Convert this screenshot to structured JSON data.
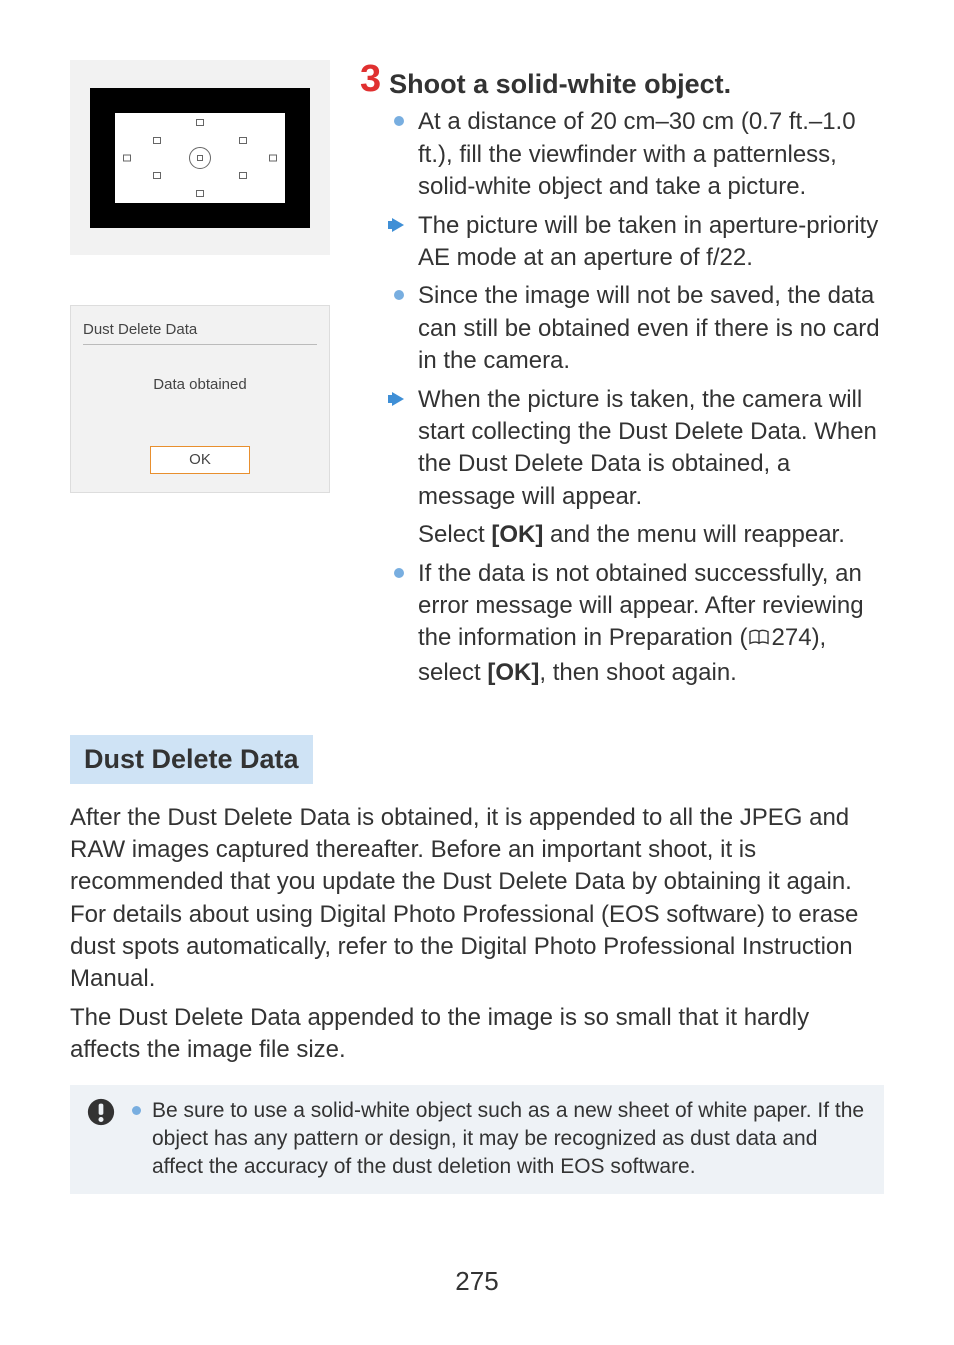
{
  "step": {
    "number": "3",
    "title": "Shoot a solid-white object.",
    "items": [
      {
        "kind": "bullet",
        "text": "At a distance of 20 cm–30 cm (0.7 ft.–1.0 ft.), fill the viewfinder with a patternless, solid-white object and take a picture."
      },
      {
        "kind": "arrow",
        "text": "The picture will be taken in aperture-priority AE mode at an aperture of f/22."
      },
      {
        "kind": "bullet",
        "text": "Since the image will not be saved, the data can still be obtained even if there is no card in the camera."
      },
      {
        "kind": "arrow",
        "text": "When the picture is taken, the camera will start collecting the Dust Delete Data. When the Dust Delete Data is obtained, a message will appear."
      },
      {
        "kind": "plain",
        "text_pre": "Select ",
        "bold1": "[OK]",
        "text_post": " and the menu will reappear."
      },
      {
        "kind": "bullet",
        "text_pre": "If the data is not obtained successfully, an error message will appear. After reviewing the information in Preparation (",
        "ref": "274",
        "text_mid": "), select ",
        "bold1": "[OK]",
        "text_post": ", then shoot again."
      }
    ]
  },
  "dialog": {
    "title": "Dust Delete Data",
    "message": "Data obtained",
    "ok": "OK"
  },
  "section": {
    "label": "Dust Delete Data",
    "para1": "After the Dust Delete Data is obtained, it is appended to all the JPEG and RAW images captured thereafter. Before an important shoot, it is recommended that you update the Dust Delete Data by obtaining it again. For details about using Digital Photo Professional (EOS software) to erase dust spots automatically, refer to the Digital Photo Professional Instruction Manual.",
    "para2": "The Dust Delete Data appended to the image is so small that it hardly affects the image file size."
  },
  "warning": {
    "text": "Be sure to use a solid-white object such as a new sheet of white paper. If the object has any pattern or design, it may be recognized as dust data and affect the accuracy of the dust deletion with EOS software."
  },
  "page_number": "275"
}
